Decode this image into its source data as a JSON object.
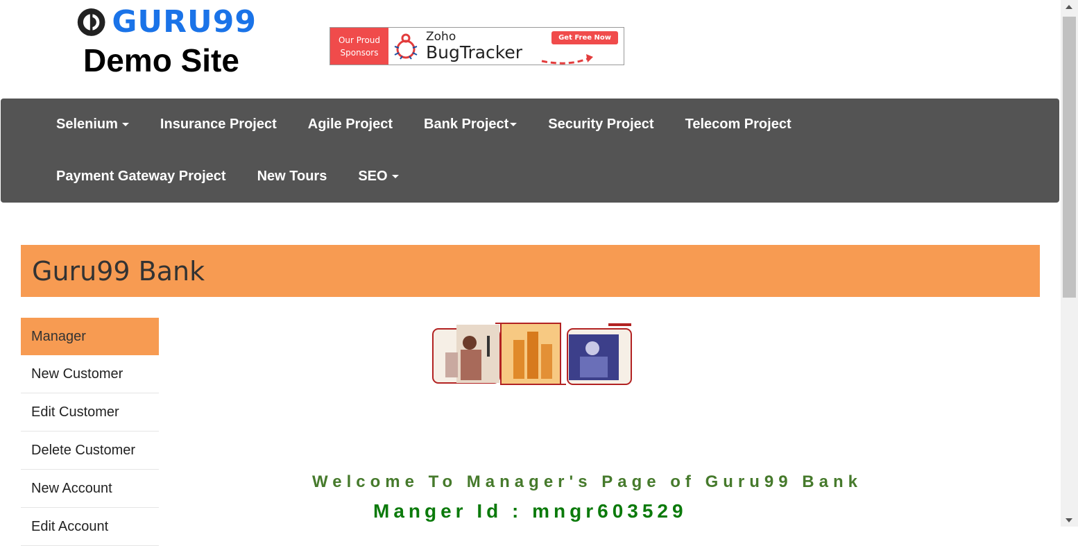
{
  "header": {
    "logo_text": "GURU99",
    "site_title": "Demo Site"
  },
  "sponsor": {
    "label_line1": "Our Proud",
    "label_line2": "Sponsors",
    "brand_small": "Zoho",
    "brand_big": "BugTracker",
    "cta": "Get Free Now"
  },
  "nav": {
    "row1": [
      {
        "label": "Selenium",
        "dropdown": true
      },
      {
        "label": "Insurance Project",
        "dropdown": false
      },
      {
        "label": "Agile Project",
        "dropdown": false
      },
      {
        "label": "Bank Project",
        "dropdown": true
      },
      {
        "label": "Security Project",
        "dropdown": false
      },
      {
        "label": "Telecom Project",
        "dropdown": false
      }
    ],
    "row2": [
      {
        "label": "Payment Gateway Project",
        "dropdown": false
      },
      {
        "label": "New Tours",
        "dropdown": false
      },
      {
        "label": "SEO",
        "dropdown": true
      }
    ]
  },
  "banner": {
    "title": "Guru99 Bank"
  },
  "sidebar": {
    "items": [
      {
        "label": "Manager",
        "active": true
      },
      {
        "label": "New Customer",
        "active": false
      },
      {
        "label": "Edit Customer",
        "active": false
      },
      {
        "label": "Delete Customer",
        "active": false
      },
      {
        "label": "New Account",
        "active": false
      },
      {
        "label": "Edit Account",
        "active": false
      }
    ]
  },
  "main": {
    "welcome": "Welcome To Manager's Page of Guru99 Bank",
    "manager_id": "Manger Id : mngr603529"
  },
  "colors": {
    "accent": "#f79b52",
    "nav_bg": "#545454",
    "welcome": "#467a2c",
    "manager_id": "#0b7a0b"
  }
}
